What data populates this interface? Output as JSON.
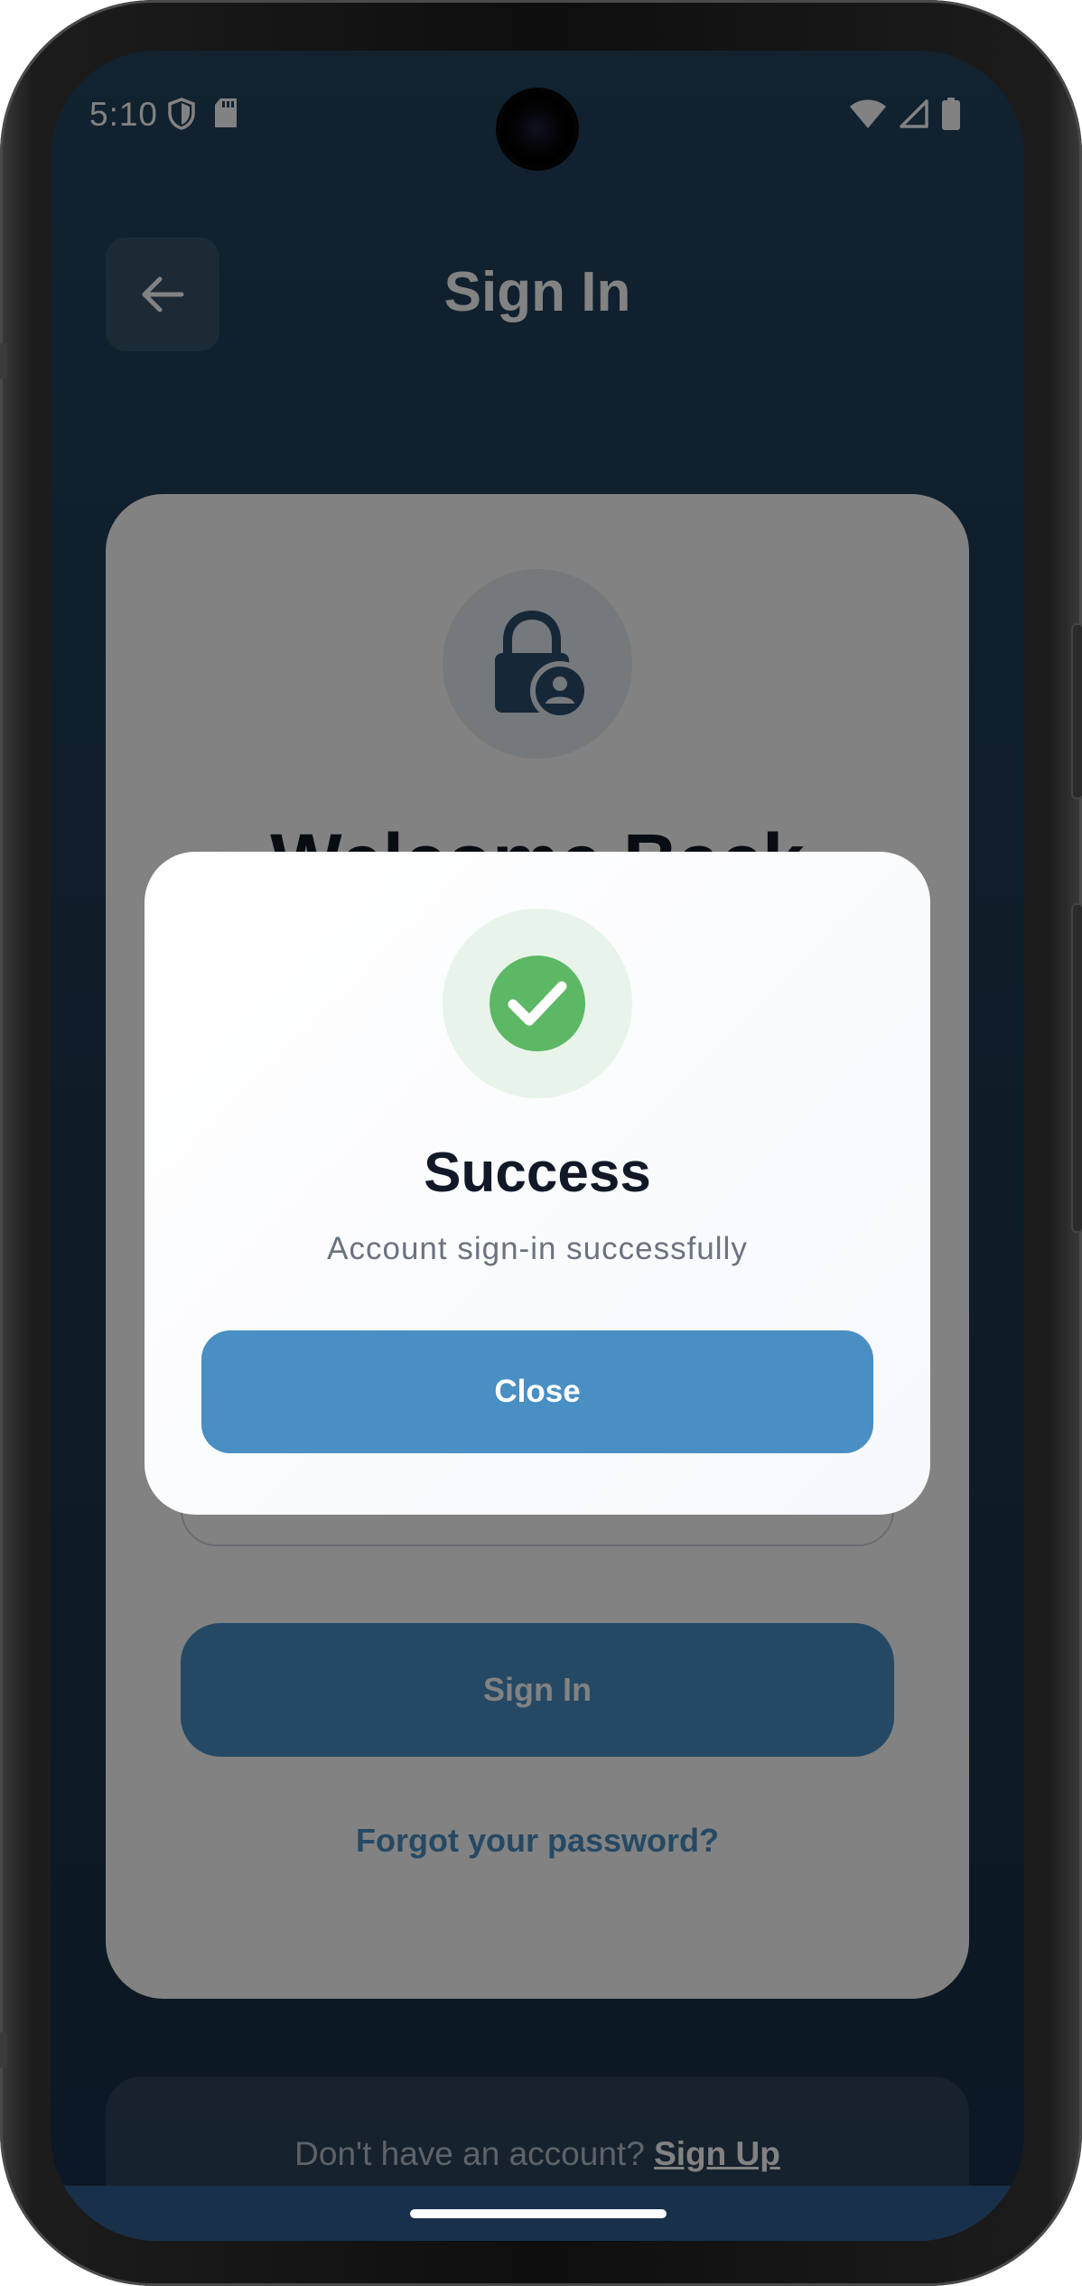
{
  "status_bar": {
    "time": "5:10",
    "icons_left": [
      "shield-icon",
      "sd-card-icon"
    ],
    "icons_right": [
      "wifi-icon",
      "signal-icon",
      "battery-icon"
    ]
  },
  "header": {
    "title": "Sign In",
    "back_icon": "arrow-left-icon"
  },
  "login_card": {
    "icon": "lock-person-icon",
    "welcome": "Welcome Back",
    "sign_in_button": "Sign In",
    "forgot_link": "Forgot your password?"
  },
  "signup": {
    "prompt": "Don't have an account?",
    "link": "Sign Up"
  },
  "dialog": {
    "icon": "check-circle-icon",
    "title": "Success",
    "message": "Account sign-in successfully",
    "close_button": "Close"
  },
  "colors": {
    "primary": "#4a8fc4",
    "success": "#5cb865",
    "background": "#23435e",
    "overlay": "rgba(0,0,0,0.49)"
  }
}
